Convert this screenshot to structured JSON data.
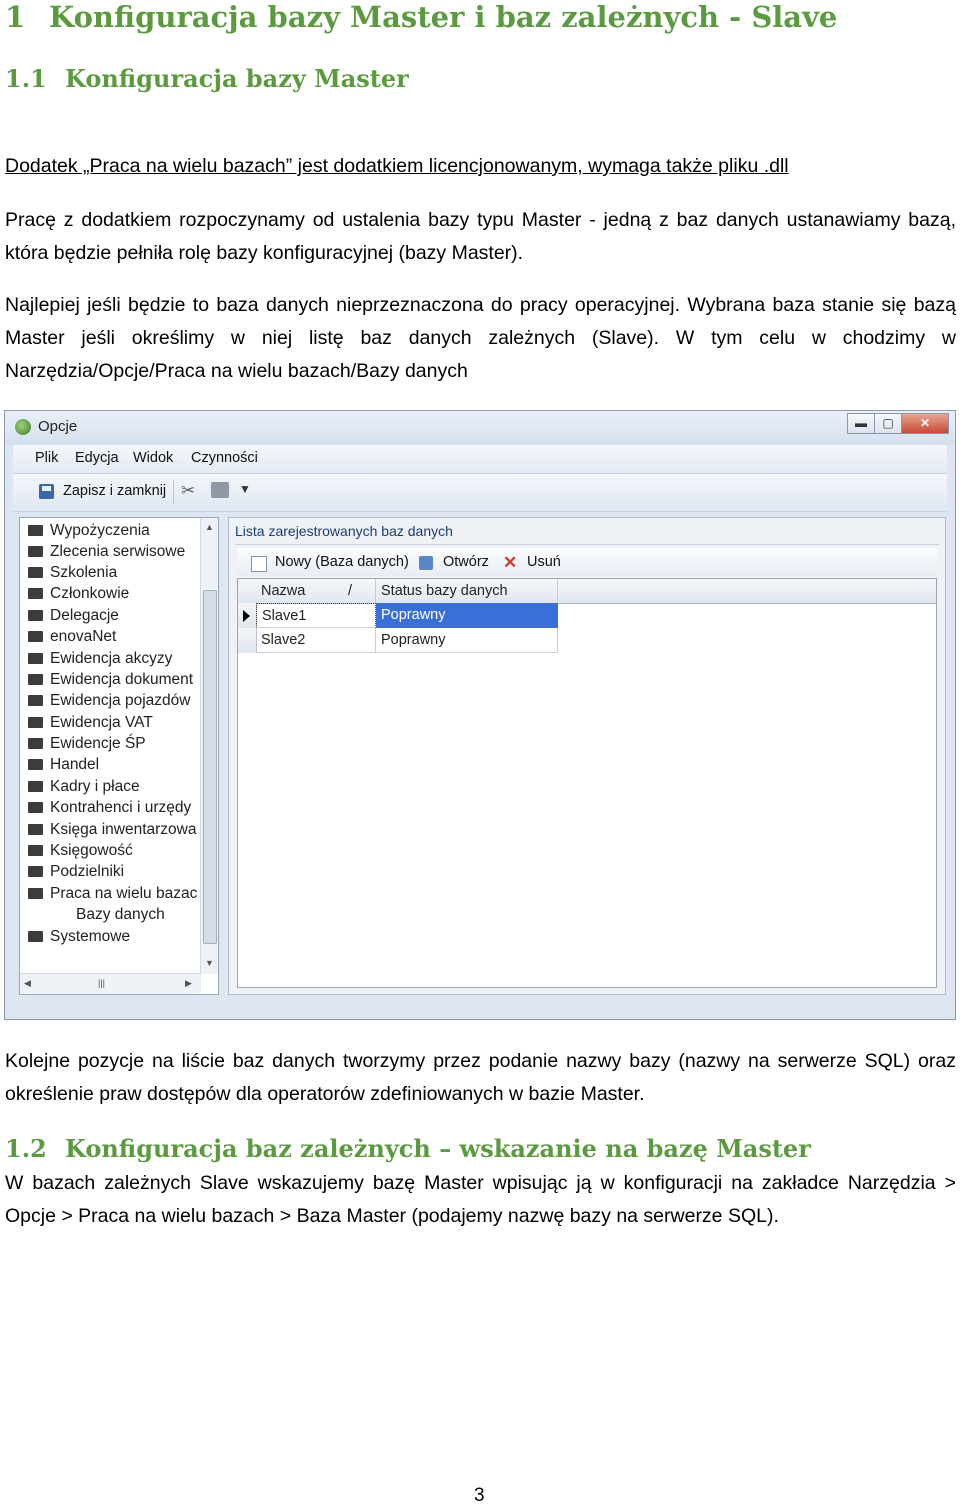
{
  "heading1": {
    "number": "1",
    "text": "Konfiguracja bazy Master i baz zależnych - Slave"
  },
  "heading2": {
    "number": "1.1",
    "text": "Konfiguracja bazy Master"
  },
  "para1": "Dodatek „Praca na wielu bazach” jest dodatkiem licencjonowanym, wymaga także pliku .dll",
  "para2": "Pracę z dodatkiem rozpoczynamy od ustalenia bazy typu Master - jedną z baz danych ustanawiamy bazą, która będzie pełniła rolę bazy konfiguracyjnej (bazy Master).",
  "para3": "Najlepiej jeśli będzie to baza danych nieprzeznaczona do pracy operacyjnej. Wybrana baza stanie się bazą Master jeśli określimy w niej listę baz danych zależnych (Slave). W tym celu w chodzimy w Narzędzia/Opcje/Praca na wielu bazach/Bazy danych",
  "window": {
    "title": "Opcje",
    "title_icon": "green-circle-icon",
    "controls": {
      "minimize": "▬",
      "maximize": "▢",
      "close": "✕"
    },
    "menu": [
      "Plik",
      "Edycja",
      "Widok",
      "Czynności"
    ],
    "toolbar": {
      "save_label": "Zapisz i zamknij"
    },
    "tree": [
      {
        "label": "Wypożyczenia"
      },
      {
        "label": "Zlecenia serwisowe"
      },
      {
        "label": "Szkolenia"
      },
      {
        "label": "Członkowie"
      },
      {
        "label": "Delegacje"
      },
      {
        "label": "enovaNet"
      },
      {
        "label": "Ewidencja akcyzy"
      },
      {
        "label": "Ewidencja dokument"
      },
      {
        "label": "Ewidencja pojazdów"
      },
      {
        "label": "Ewidencja VAT"
      },
      {
        "label": "Ewidencje ŚP"
      },
      {
        "label": "Handel"
      },
      {
        "label": "Kadry i płace"
      },
      {
        "label": "Kontrahenci i urzędy"
      },
      {
        "label": "Księga inwentarzowa"
      },
      {
        "label": "Księgowość"
      },
      {
        "label": "Podzielniki"
      },
      {
        "label": "Praca na wielu bazac"
      },
      {
        "label": "Bazy danych"
      },
      {
        "label": "Systemowe"
      }
    ],
    "panel": {
      "title": "Lista zarejestrowanych baz danych",
      "tools": {
        "new": "Nowy (Baza danych)",
        "open": "Otwórz",
        "delete": "Usuń"
      },
      "columns": [
        "Nazwa",
        "Status bazy danych"
      ],
      "rows": [
        {
          "name": "Slave1",
          "status": "Poprawny"
        },
        {
          "name": "Slave2",
          "status": "Poprawny"
        }
      ]
    },
    "colors": {
      "selection": "#3a6fd8",
      "heading": "#5b9a3f"
    }
  },
  "para4": "Kolejne pozycje na liście baz danych tworzymy przez podanie nazwy bazy (nazwy na serwerze SQL) oraz określenie praw dostępów dla operatorów zdefiniowanych w bazie Master.",
  "heading3": {
    "number": "1.2",
    "text": "Konfiguracja baz zależnych – wskazanie na bazę Master"
  },
  "para5": "W bazach zależnych Slave wskazujemy bazę Master wpisując ją w konfiguracji na zakładce Narzędzia > Opcje > Praca na wielu bazach > Baza Master (podajemy nazwę bazy na serwerze SQL).",
  "page_number": "3"
}
